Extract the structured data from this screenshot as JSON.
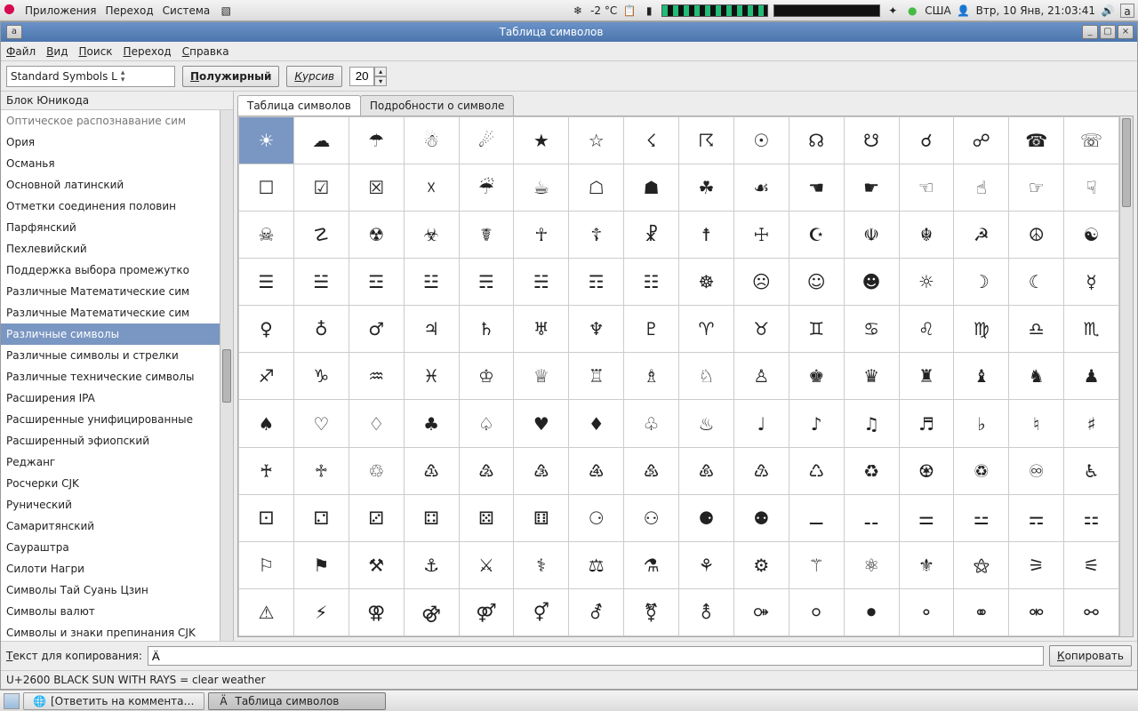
{
  "panel": {
    "menus": [
      "Приложения",
      "Переход",
      "Система"
    ],
    "temp": "-2 °С",
    "kbd": "США",
    "date": "Втр, 10 Янв, 21:03:41"
  },
  "window": {
    "title": "Таблица символов",
    "menubar": [
      "Файл",
      "Вид",
      "Поиск",
      "Переход",
      "Справка"
    ],
    "font_combo": "Standard Symbols L",
    "bold": "Полужирный",
    "italic": "Курсив",
    "size": "20"
  },
  "side": {
    "header": "Блок Юникода",
    "items": [
      {
        "label": "Оптическое распознавание сим",
        "cut": true
      },
      {
        "label": "Ория"
      },
      {
        "label": "Османья"
      },
      {
        "label": "Основной латинский"
      },
      {
        "label": "Отметки соединения половин"
      },
      {
        "label": "Парфянский"
      },
      {
        "label": "Пехлевийский"
      },
      {
        "label": "Поддержка выбора промежутко"
      },
      {
        "label": "Различные Математические сим"
      },
      {
        "label": "Различные Математические сим"
      },
      {
        "label": "Различные символы",
        "sel": true
      },
      {
        "label": "Различные символы и стрелки"
      },
      {
        "label": "Различные технические символы"
      },
      {
        "label": "Расширения IPA"
      },
      {
        "label": "Расширенные унифицированные"
      },
      {
        "label": "Расширенный эфиопский"
      },
      {
        "label": "Реджанг"
      },
      {
        "label": "Росчерки CJK"
      },
      {
        "label": "Рунический"
      },
      {
        "label": "Самаритянский"
      },
      {
        "label": "Саураштра"
      },
      {
        "label": "Силоти Нагри"
      },
      {
        "label": "Символы Тай Суань Цзин"
      },
      {
        "label": "Символы валют"
      },
      {
        "label": "Символы и знаки препинания CJK"
      }
    ]
  },
  "tabs": {
    "active": "Таблица символов",
    "inactive": "Подробности о символе"
  },
  "grid": {
    "cols": 16,
    "selected": 0,
    "chars": [
      "☀",
      "☁",
      "☂",
      "☃",
      "☄",
      "★",
      "☆",
      "☇",
      "☈",
      "☉",
      "☊",
      "☋",
      "☌",
      "☍",
      "☎",
      "☏",
      "☐",
      "☑",
      "☒",
      "☓",
      "☔",
      "☕",
      "☖",
      "☗",
      "☘",
      "☙",
      "☚",
      "☛",
      "☜",
      "☝",
      "☞",
      "☟",
      "☠",
      "☡",
      "☢",
      "☣",
      "☤",
      "☥",
      "☦",
      "☧",
      "☨",
      "☩",
      "☪",
      "☫",
      "☬",
      "☭",
      "☮",
      "☯",
      "☰",
      "☱",
      "☲",
      "☳",
      "☴",
      "☵",
      "☶",
      "☷",
      "☸",
      "☹",
      "☺",
      "☻",
      "☼",
      "☽",
      "☾",
      "☿",
      "♀",
      "♁",
      "♂",
      "♃",
      "♄",
      "♅",
      "♆",
      "♇",
      "♈",
      "♉",
      "♊",
      "♋",
      "♌",
      "♍",
      "♎",
      "♏",
      "♐",
      "♑",
      "♒",
      "♓",
      "♔",
      "♕",
      "♖",
      "♗",
      "♘",
      "♙",
      "♚",
      "♛",
      "♜",
      "♝",
      "♞",
      "♟",
      "♠",
      "♡",
      "♢",
      "♣",
      "♤",
      "♥",
      "♦",
      "♧",
      "♨",
      "♩",
      "♪",
      "♫",
      "♬",
      "♭",
      "♮",
      "♯",
      "♰",
      "♱",
      "♲",
      "♳",
      "♴",
      "♵",
      "♶",
      "♷",
      "♸",
      "♹",
      "♺",
      "♻",
      "♼",
      "♽",
      "♾",
      "♿",
      "⚀",
      "⚁",
      "⚂",
      "⚃",
      "⚄",
      "⚅",
      "⚆",
      "⚇",
      "⚈",
      "⚉",
      "⚊",
      "⚋",
      "⚌",
      "⚍",
      "⚎",
      "⚏",
      "⚐",
      "⚑",
      "⚒",
      "⚓",
      "⚔",
      "⚕",
      "⚖",
      "⚗",
      "⚘",
      "⚙",
      "⚚",
      "⚛",
      "⚜",
      "⚝",
      "⚞",
      "⚟",
      "⚠",
      "⚡",
      "⚢",
      "⚣",
      "⚤",
      "⚥",
      "⚦",
      "⚧",
      "⚨",
      "⚩",
      "⚪",
      "⚫",
      "⚬",
      "⚭",
      "⚮",
      "⚯"
    ]
  },
  "copy": {
    "label": "Текст для копирования:",
    "value": "Ӓ",
    "button": "Копировать"
  },
  "status": "U+2600 BLACK SUN WITH RAYS   = clear weather",
  "taskbar": {
    "items": [
      {
        "label": "[Ответить на коммента…",
        "icon": "🌐"
      },
      {
        "label": "Таблица символов",
        "icon": "Ä",
        "active": true
      }
    ]
  }
}
